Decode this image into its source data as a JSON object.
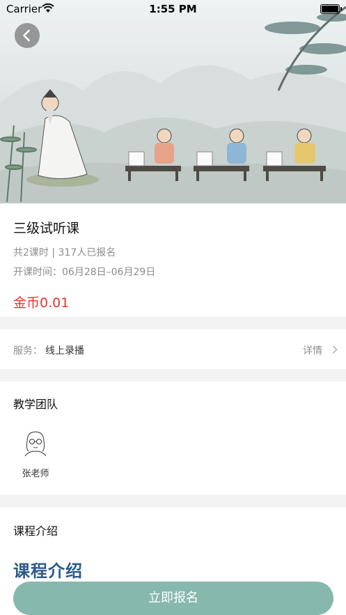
{
  "status_bar": {
    "carrier": "Carrier",
    "time": "1:55 PM"
  },
  "course": {
    "title": "三级试听课",
    "meta": "共2课时 | 317人已报名",
    "dates": "开课时间：06月28日–06月29日",
    "price": "金币0.01"
  },
  "service": {
    "label": "服务：",
    "value": "线上录播",
    "detail": "详情"
  },
  "team": {
    "title": "教学团队",
    "teachers": [
      {
        "name": "张老师"
      }
    ]
  },
  "intro": {
    "title": "课程介绍",
    "heading": "课程介绍"
  },
  "enroll_button": {
    "label": "立即报名"
  },
  "colors": {
    "price": "#e8352e",
    "button": "#86b8ad",
    "heading": "#2c5a8a"
  },
  "icons": [
    "wifi-icon",
    "battery-icon",
    "back-arrow-icon",
    "chevron-right-icon"
  ]
}
